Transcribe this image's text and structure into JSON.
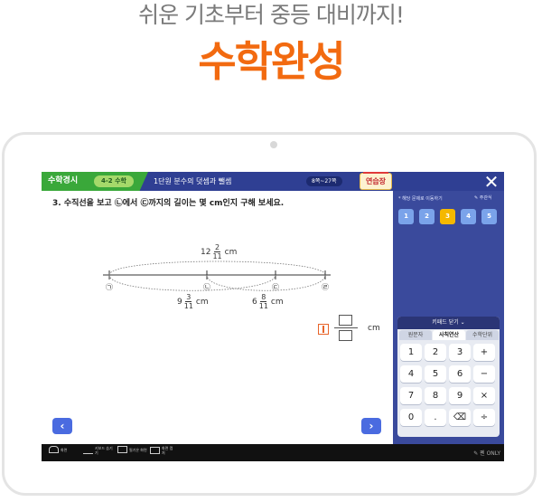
{
  "hero": {
    "subtitle": "쉬운 기초부터 중등 대비까지!",
    "title": "수학완성"
  },
  "topbar": {
    "app_title": "수학경시",
    "grade_badge": "4-2 수학",
    "lesson_title": "1단원 분수의 덧셈과 뺄셈",
    "page_range": "8쪽~27쪽",
    "practice_label": "연습장",
    "close_icon": "close-icon"
  },
  "question": {
    "text": "3. 수직선을 보고 ㉡에서 ㉢까지의 길이는 몇 cm인지 구해 보세요.",
    "top_length": {
      "whole": "12",
      "num": "2",
      "den": "11",
      "unit": "cm"
    },
    "left_length": {
      "whole": "9",
      "num": "3",
      "den": "11",
      "unit": "cm"
    },
    "right_length": {
      "whole": "6",
      "num": "8",
      "den": "11",
      "unit": "cm"
    },
    "points": [
      "㉠",
      "㉡",
      "㉢",
      "㉣"
    ],
    "answer_unit": "cm"
  },
  "nav": {
    "prev": "‹",
    "next": "›"
  },
  "panel": {
    "hint": "* 해당 문제로 이동하기",
    "select_label": "주관식",
    "question_numbers": [
      "1",
      "2",
      "3",
      "4",
      "5"
    ],
    "active_question": 3
  },
  "keypad": {
    "header": "키패드 닫기 ⌄",
    "tabs": [
      "원문자",
      "사칙연산",
      "수학단위"
    ],
    "active_tab": "사칙연산",
    "keys": [
      [
        "1",
        "2",
        "3",
        "+"
      ],
      [
        "4",
        "5",
        "6",
        "−"
      ],
      [
        "7",
        "8",
        "9",
        "×"
      ],
      [
        "0",
        ".",
        "⌫",
        "÷"
      ]
    ]
  },
  "bottombar": {
    "items": [
      "화면",
      "키보드 숨기기",
      "필기온 화면",
      "화면 캡처"
    ],
    "pen_only": "✎ 펜 ONLY"
  },
  "colors": {
    "accent_orange": "#f26a10",
    "screen_blue": "#3a4a9c",
    "active_yellow": "#f5b800",
    "tab_green": "#3aa83a"
  }
}
